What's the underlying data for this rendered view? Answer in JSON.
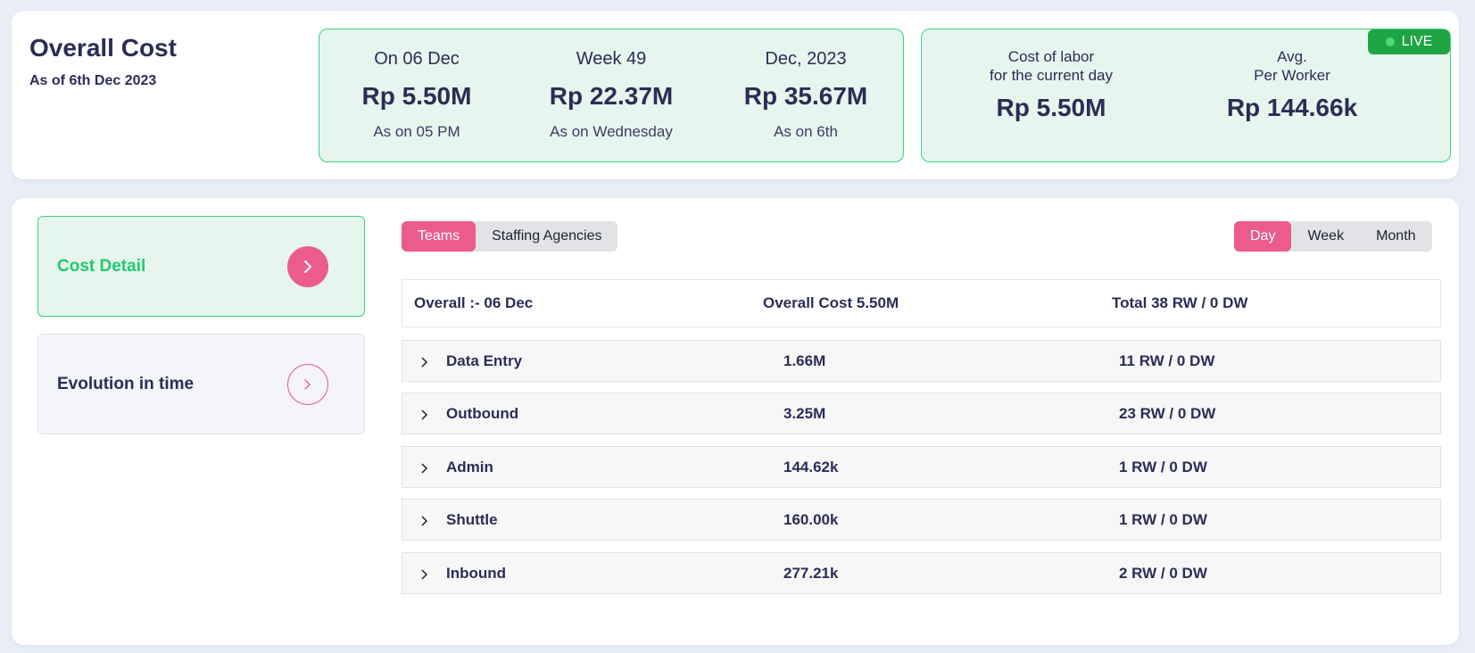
{
  "header": {
    "title": "Overall Cost",
    "subtitle": "As of 6th Dec 2023"
  },
  "periods": [
    {
      "label": "On 06 Dec",
      "value": "Rp 5.50M",
      "note": "As on 05 PM"
    },
    {
      "label": "Week 49",
      "value": "Rp 22.37M",
      "note": "As on Wednesday"
    },
    {
      "label": "Dec, 2023",
      "value": "Rp 35.67M",
      "note": "As on 6th"
    }
  ],
  "labor": {
    "live_label": "LIVE",
    "current_day": {
      "label_line1": "Cost of labor",
      "label_line2": "for the current day",
      "value": "Rp 5.50M"
    },
    "avg": {
      "label_line1": "Avg.",
      "label_line2": "Per Worker",
      "value": "Rp 144.66k"
    }
  },
  "sidebar": {
    "items": [
      {
        "label": "Cost Detail",
        "active": true
      },
      {
        "label": "Evolution in time",
        "active": false
      }
    ]
  },
  "group_toggle": {
    "options": [
      "Teams",
      "Staffing Agencies"
    ],
    "selected": "Teams"
  },
  "period_toggle": {
    "options": [
      "Day",
      "Week",
      "Month"
    ],
    "selected": "Day"
  },
  "table": {
    "header": {
      "overall": "Overall :- 06 Dec",
      "cost": "Overall Cost 5.50M",
      "total": "Total 38 RW / 0 DW"
    },
    "rows": [
      {
        "team": "Data Entry",
        "cost": "1.66M",
        "workers": "11 RW / 0 DW"
      },
      {
        "team": "Outbound",
        "cost": "3.25M",
        "workers": "23 RW / 0 DW"
      },
      {
        "team": "Admin",
        "cost": "144.62k",
        "workers": "1 RW / 0 DW"
      },
      {
        "team": "Shuttle",
        "cost": "160.00k",
        "workers": "1 RW / 0 DW"
      },
      {
        "team": "Inbound",
        "cost": "277.21k",
        "workers": "2 RW / 0 DW"
      }
    ]
  },
  "colors": {
    "accent_pink": "#ec5b8d",
    "accent_green": "#36d67e",
    "live_green": "#1fa544",
    "text_navy": "#2b2d55"
  }
}
